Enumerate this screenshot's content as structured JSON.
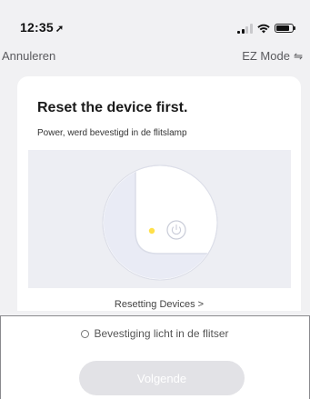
{
  "status_bar": {
    "time": "12:35",
    "location_glyph": "➚",
    "icons": [
      "signal-icon",
      "wifi-icon",
      "battery-icon"
    ]
  },
  "nav": {
    "cancel_label": "Annuleren",
    "mode_label": "EZ Mode",
    "mode_icon": "⇋"
  },
  "card": {
    "title": "Reset the device first.",
    "subtitle": "Power, werd bevestigd in de flitslamp",
    "link_label": "Resetting Devices >"
  },
  "footer": {
    "confirm_label": "Bevestiging licht in de flitser",
    "next_label": "Volgende"
  },
  "colors": {
    "indicator_light": "#ffe04a",
    "button_disabled": "#e2e2e6"
  }
}
